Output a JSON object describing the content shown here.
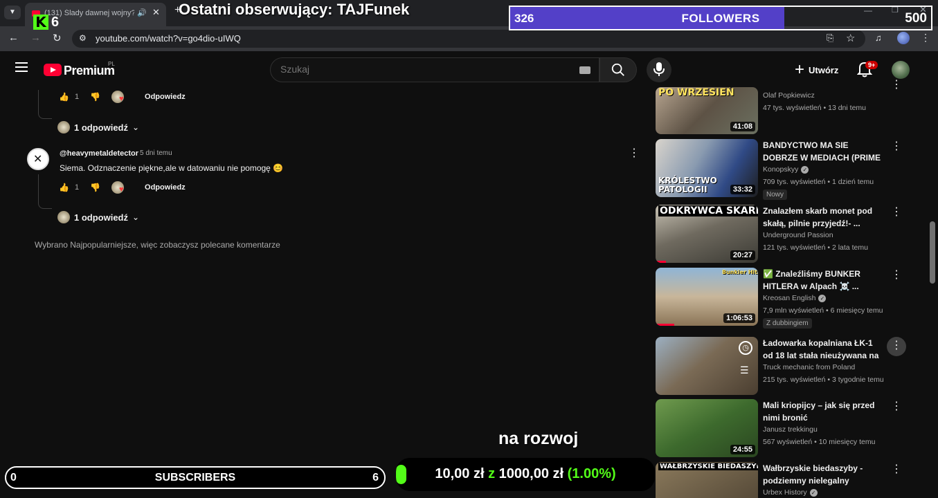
{
  "browser": {
    "tab_title": "(131) Ślady dawnej wojny?!",
    "url": "youtube.com/watch?v=go4dio-uIWQ",
    "icons": {
      "tab_menu": "chevron-down-icon",
      "audio": "speaker-icon",
      "close": "close-icon",
      "new_tab": "plus-icon"
    }
  },
  "overlay": {
    "kick_count": "6",
    "last_follower": "Ostatni obserwujący: TAJFunek",
    "followers": {
      "current": "326",
      "label": "FOLLOWERS",
      "goal": "500",
      "progress": 0.652,
      "fill_color": "#5340c8"
    },
    "subscribers": {
      "current": "0",
      "label": "SUBSCRIBERS",
      "goal": "6"
    },
    "donation": {
      "raised": "10,00 zł",
      "sep": "z",
      "goal": "1000,00 zł",
      "percent": "(1.00%)",
      "progress": 0.01,
      "accent": "#53fc18"
    },
    "caption": "na rozwoj"
  },
  "yt_header": {
    "brand": "Premium",
    "region": "PL",
    "search_placeholder": "Szukaj",
    "create_label": "Utwórz",
    "notifications": "9+"
  },
  "comments": {
    "top_reply": {
      "likes": "1",
      "reply_label": "Odpowiedz"
    },
    "top_replies_toggle": "1 odpowiedź",
    "comment": {
      "author": "@heavymetaldetector",
      "time": "5 dni temu",
      "text": "Siema. Odznaczenie piękne,ale w datowaniu nie pomogę 😊",
      "likes": "1",
      "reply_label": "Odpowiedz",
      "replies_toggle": "1 odpowiedź"
    },
    "sort_notice": "Wybrano Najpopularniejsze, więc zobaczysz polecane komentarze"
  },
  "recommendations": [
    {
      "title": "",
      "thumb_text": "PO WRZESIEŃ",
      "channel": "Olaf Popkiewicz",
      "verified": false,
      "meta": "47 tys. wyświetleń • 13 dni temu",
      "duration": "41:08",
      "badge": ""
    },
    {
      "title": "BANDYCTWO MA SIE DOBRZE W MEDIACH (PRIME MMA, ...",
      "thumb_text": "KRÓLESTWO PATOLOGII",
      "channel": "Konopskyy",
      "verified": true,
      "meta": "709 tys. wyświetleń • 1 dzień temu",
      "duration": "33:32",
      "badge": "Nowy"
    },
    {
      "title": "Znalazłem skarb monet pod skałą, pilnie przyjedź!- ...",
      "thumb_text": "ODKRYWCA SKARBU",
      "channel": "Underground Passion",
      "verified": false,
      "meta": "121 tys. wyświetleń • 2 lata temu",
      "duration": "20:27",
      "badge": ""
    },
    {
      "title": "✅ Znaleźliśmy BUNKER HITLERA w Alpach ☠️ ...",
      "thumb_text": "Bunkier Hitlera",
      "channel": "Kreosan English",
      "verified": true,
      "meta": "7,9 mln wyświetleń • 6 miesięcy temu",
      "duration": "1:06:53",
      "badge": "Z dubbingiem"
    },
    {
      "title": "Ładowarka kopalniana ŁK-1 od 18 lat stała nieużywana na ...",
      "thumb_text": "",
      "channel": "Truck mechanic from Poland",
      "verified": false,
      "meta": "215 tys. wyświetleń • 3 tygodnie temu",
      "duration": "",
      "badge": ""
    },
    {
      "title": "Mali kriopijcy – jak się przed nimi bronić",
      "thumb_text": "",
      "channel": "Janusz trekkingu",
      "verified": false,
      "meta": "567 wyświetleń • 10 miesięcy temu",
      "duration": "24:55",
      "badge": ""
    },
    {
      "title": "Wałbrzyskie biedaszyby - podziemny nielegalny biznes?",
      "thumb_text": "WAŁBRZYSKIE BIEDASZYBY",
      "channel": "Urbex History",
      "verified": true,
      "meta": "",
      "duration": "",
      "badge": ""
    }
  ]
}
